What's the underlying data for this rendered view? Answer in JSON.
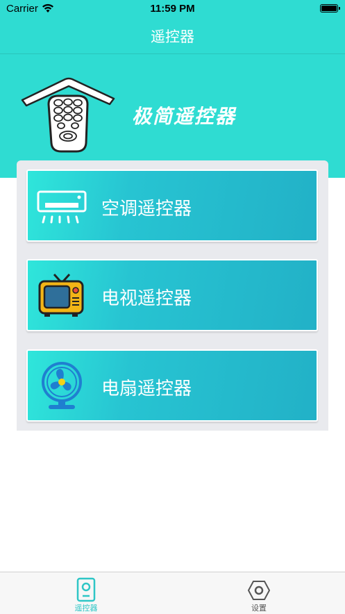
{
  "status_bar": {
    "carrier": "Carrier",
    "time": "11:59 PM"
  },
  "nav": {
    "title": "遥控器"
  },
  "banner": {
    "title": "极简遥控器"
  },
  "cards": [
    {
      "label": "空调遥控器",
      "icon": "air-conditioner-icon"
    },
    {
      "label": "电视遥控器",
      "icon": "tv-icon"
    },
    {
      "label": "电扇遥控器",
      "icon": "fan-icon"
    }
  ],
  "tabs": [
    {
      "label": "遥控器",
      "icon": "remote-icon",
      "active": true
    },
    {
      "label": "设置",
      "icon": "settings-hex-icon",
      "active": false
    }
  ],
  "colors": {
    "primary": "#2fdcd2",
    "tab_active": "#2ec6c6",
    "tab_inactive": "#555555",
    "panel_bg": "#e9eaee"
  }
}
